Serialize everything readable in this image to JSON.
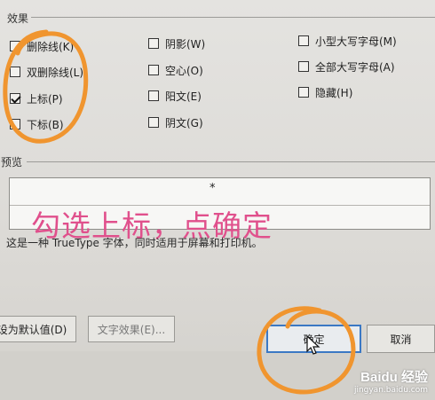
{
  "effects": {
    "group_label": "效果",
    "col1": [
      {
        "label": "删除线(K)",
        "checked": false
      },
      {
        "label": "双删除线(L)",
        "checked": false
      },
      {
        "label": "上标(P)",
        "checked": true
      },
      {
        "label": "下标(B)",
        "checked": false
      }
    ],
    "col2": [
      {
        "label": "阴影(W)",
        "checked": false
      },
      {
        "label": "空心(O)",
        "checked": false
      },
      {
        "label": "阳文(E)",
        "checked": false
      },
      {
        "label": "阴文(G)",
        "checked": false
      }
    ],
    "col3": [
      {
        "label": "小型大写字母(M)",
        "checked": false
      },
      {
        "label": "全部大写字母(A)",
        "checked": false
      },
      {
        "label": "隐藏(H)",
        "checked": false
      }
    ]
  },
  "preview": {
    "group_label": "预览",
    "sample_text": "*",
    "description": "这是一种 TrueType 字体，同时适用于屏幕和打印机。"
  },
  "buttons": {
    "set_default": "设为默认值(D)",
    "text_effects": "文字效果(E)...",
    "ok": "确定",
    "cancel": "取消"
  },
  "annotation": {
    "text": "勾选上标，点确定",
    "color": "#e0508c"
  },
  "watermark": {
    "logo": "Baidu 经验",
    "url": "jingyan.baidu.com"
  }
}
